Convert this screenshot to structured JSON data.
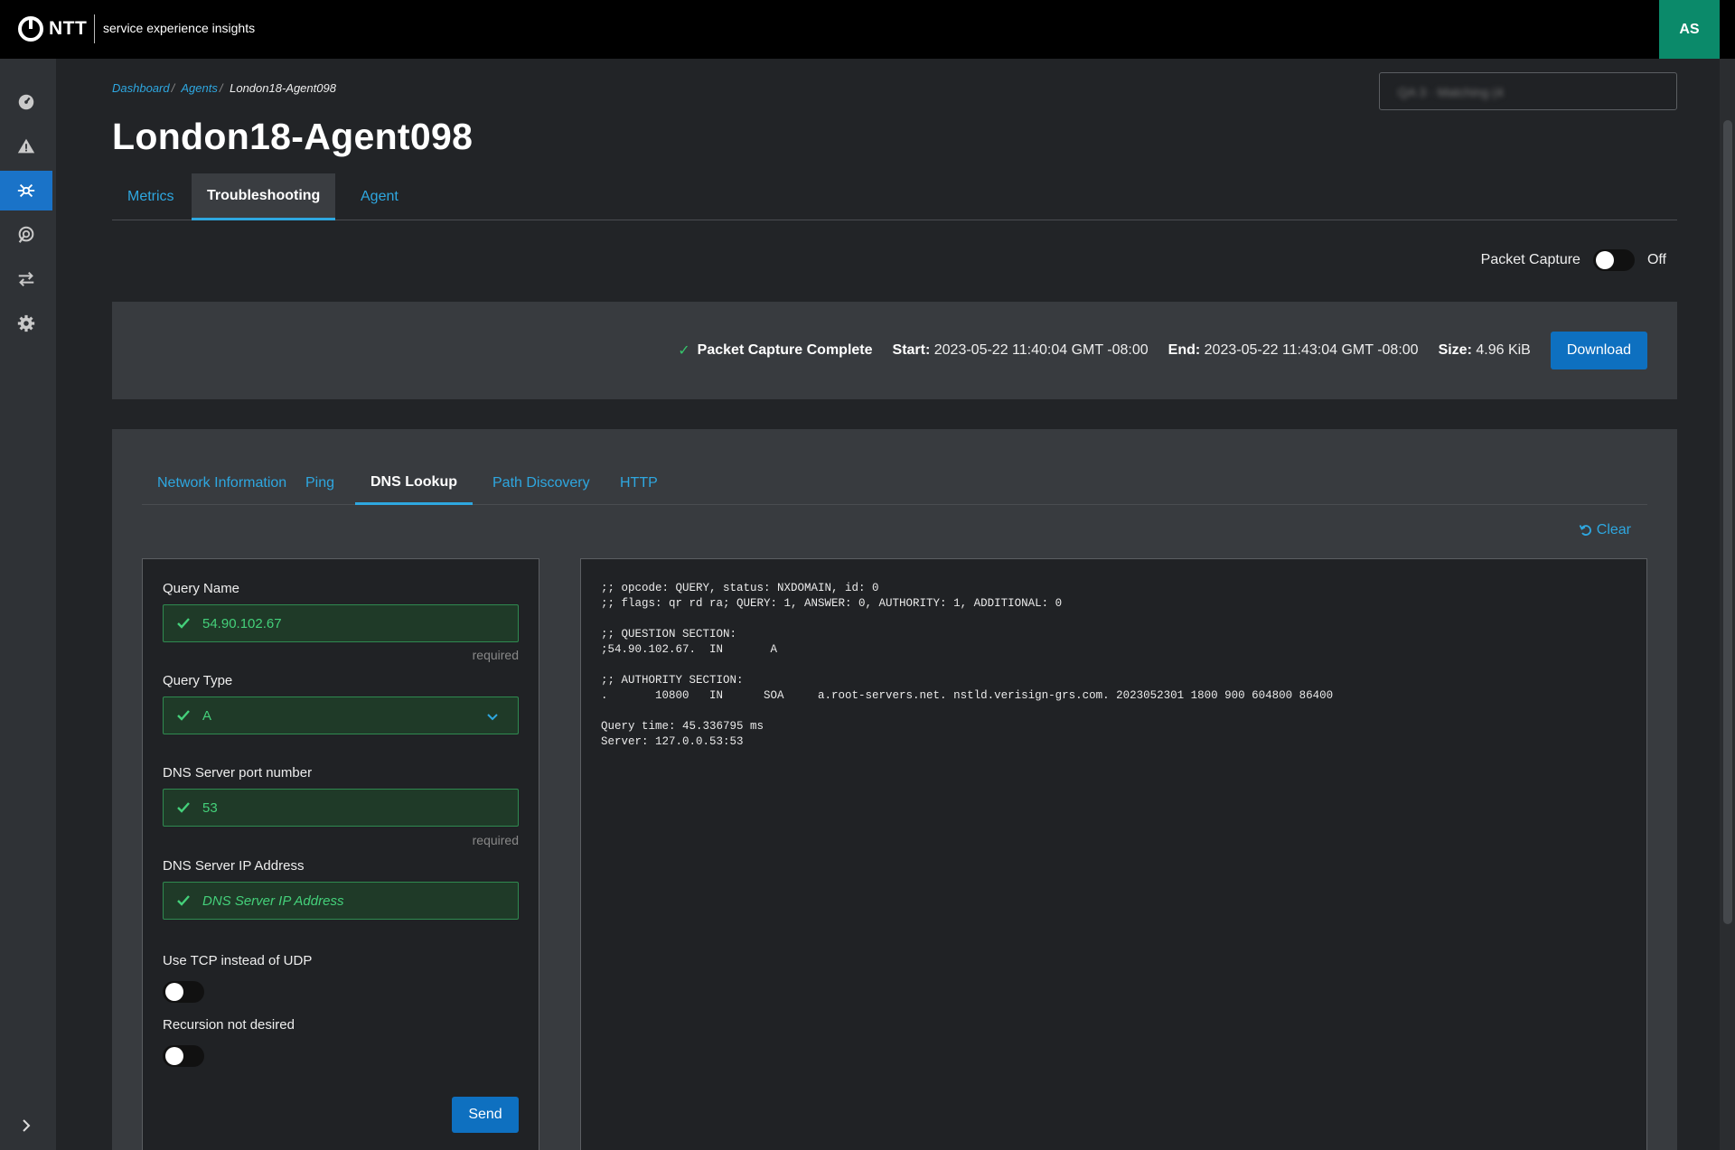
{
  "header": {
    "brand": "NTT",
    "app_name": "service experience insights",
    "user_initials": "AS"
  },
  "search": {
    "blurred_text": "QA 3 · Matching (4"
  },
  "breadcrumb": {
    "items": [
      "Dashboard",
      "Agents"
    ],
    "current": "London18-Agent098"
  },
  "page": {
    "title": "London18-Agent098"
  },
  "main_tabs": [
    "Metrics",
    "Troubleshooting",
    "Agent"
  ],
  "packet_capture_toggle": {
    "label": "Packet Capture",
    "state": "Off"
  },
  "capture": {
    "status": "Packet Capture Complete",
    "start_label": "Start:",
    "start": "2023-05-22 11:40:04 GMT -08:00",
    "end_label": "End:",
    "end": "2023-05-22 11:43:04 GMT -08:00",
    "size_label": "Size:",
    "size": "4.96 KiB",
    "download": "Download"
  },
  "tool_tabs": [
    "Network Information",
    "Ping",
    "DNS Lookup",
    "Path Discovery",
    "HTTP"
  ],
  "clear": "Clear",
  "form": {
    "query_name": {
      "label": "Query Name",
      "value": "54.90.102.67",
      "hint": "required"
    },
    "query_type": {
      "label": "Query Type",
      "value": "A"
    },
    "dns_port": {
      "label": "DNS Server port number",
      "value": "53",
      "hint": "required"
    },
    "dns_ip": {
      "label": "DNS Server IP Address",
      "placeholder": "DNS Server IP Address"
    },
    "use_tcp": {
      "label": "Use TCP instead of UDP"
    },
    "no_recursion": {
      "label": "Recursion not desired"
    },
    "send": "Send"
  },
  "output": ";; opcode: QUERY, status: NXDOMAIN, id: 0\n;; flags: qr rd ra; QUERY: 1, ANSWER: 0, AUTHORITY: 1, ADDITIONAL: 0\n\n;; QUESTION SECTION:\n;54.90.102.67.  IN       A\n\n;; AUTHORITY SECTION:\n.       10800   IN      SOA     a.root-servers.net. nstld.verisign-grs.com. 2023052301 1800 900 604800 86400\n\nQuery time: 45.336795 ms\nServer: 127.0.0.53:53",
  "colors": {
    "accent": "#2ea7e0",
    "primary": "#0e70c0",
    "success": "#35c46b",
    "avatar": "#0b8a6a"
  },
  "icons": {
    "sidebar": [
      "dashboard-gauge-icon",
      "alert-triangle-icon",
      "agents-network-icon",
      "radar-icon",
      "transfer-arrows-icon",
      "settings-gear-icon"
    ],
    "expand": "chevron-right-icon"
  }
}
